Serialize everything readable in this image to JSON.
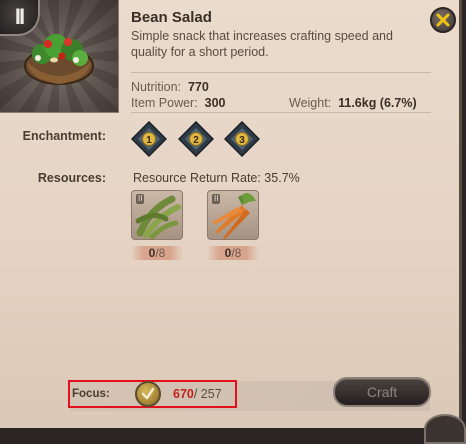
{
  "item": {
    "name": "Bean Salad",
    "description": "Simple snack that increases crafting speed and quality for a short period."
  },
  "stats": {
    "nutrition_label": "Nutrition:",
    "nutrition_value": "770",
    "item_power_label": "Item Power:",
    "item_power_value": "300",
    "weight_label": "Weight:",
    "weight_value": "11.6kg (6.7%)"
  },
  "enchantment": {
    "label": "Enchantment:",
    "levels": [
      "1",
      "2",
      "3"
    ]
  },
  "resources": {
    "label": "Resources:",
    "return_rate_text": "Resource Return Rate: 35.7%",
    "items": [
      {
        "icon": "beans-icon",
        "tier": "II",
        "have": "0",
        "need": "/8"
      },
      {
        "icon": "carrots-icon",
        "tier": "II",
        "have": "0",
        "need": "/8"
      }
    ]
  },
  "focus": {
    "label": "Focus:",
    "current": "670",
    "max": "/ 257",
    "icon": "checkmark-icon"
  },
  "buttons": {
    "craft_label": "Craft",
    "pause_icon": "pause-icon",
    "close_icon": "close-icon"
  },
  "colors": {
    "focus_highlight": "#e3101c",
    "focus_current": "#c0221a",
    "panel_bg": "#eadbcd"
  }
}
